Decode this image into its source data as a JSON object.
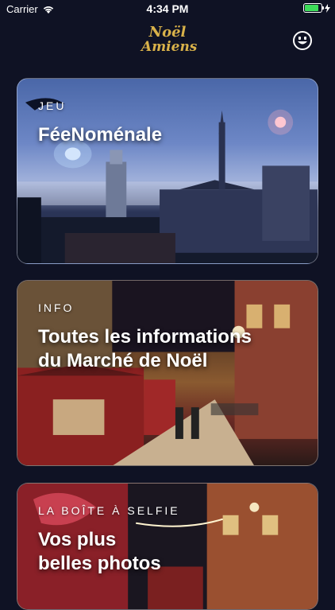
{
  "status_bar": {
    "carrier": "Carrier",
    "time": "4:34 PM",
    "battery_level": 0.85
  },
  "header": {
    "logo_line1": "Noël",
    "logo_line2": "Amiens",
    "logo_color": "#d9b24a",
    "profile_icon": "smiley-icon"
  },
  "cards": [
    {
      "eyebrow": "JEU",
      "title_line1": "FéeNoménale",
      "title_line2": ""
    },
    {
      "eyebrow": "INFO",
      "title_line1": "Toutes les informations",
      "title_line2": "du Marché de Noël"
    },
    {
      "eyebrow": "LA BOÎTE À SELFIE",
      "title_line1": "Vos plus",
      "title_line2": "belles photos"
    }
  ]
}
